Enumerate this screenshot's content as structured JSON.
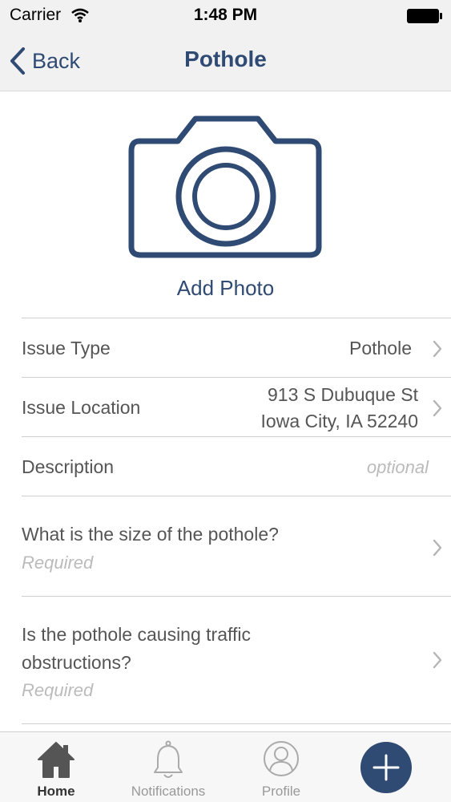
{
  "status_bar": {
    "carrier": "Carrier",
    "time": "1:48 PM"
  },
  "nav": {
    "back_label": "Back",
    "title": "Pothole"
  },
  "photo": {
    "label": "Add Photo"
  },
  "form": {
    "issue_type": {
      "label": "Issue Type",
      "value": "Pothole"
    },
    "issue_location": {
      "label": "Issue Location",
      "line1": "913 S Dubuque St",
      "line2": "Iowa City, IA 52240"
    },
    "description": {
      "label": "Description",
      "placeholder": "optional"
    },
    "q1": {
      "label": "What is the size of the pothole?",
      "hint": "Required"
    },
    "q2": {
      "label_line1": "Is the pothole causing traffic",
      "label_line2": "obstructions?",
      "hint": "Required"
    }
  },
  "tabs": [
    {
      "label": "Home",
      "icon": "home-icon",
      "active": true
    },
    {
      "label": "Notifications",
      "icon": "bell-icon",
      "active": false
    },
    {
      "label": "Profile",
      "icon": "profile-icon",
      "active": false
    }
  ],
  "colors": {
    "brand": "#2f4a73",
    "placeholder": "#bbbbbb",
    "chrome": "#f1f1f1"
  }
}
